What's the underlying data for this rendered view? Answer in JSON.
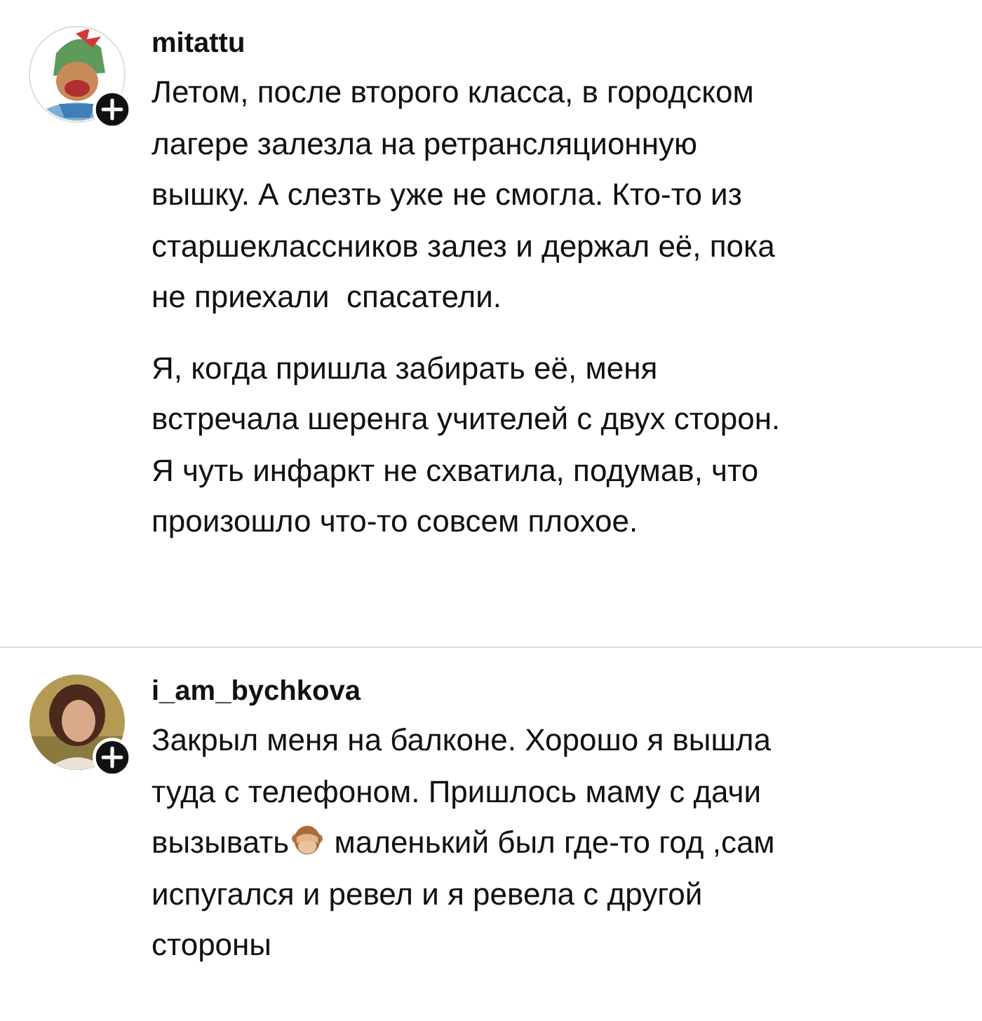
{
  "comments": [
    {
      "username": "mitattu",
      "avatar": {
        "kind": "cartoon"
      },
      "paragraphs": [
        [
          "Летом, после второго класса, в городском",
          "лагере залезла на ретрансляционную",
          "вышку. А слезть уже не смогла. Кто-то из",
          "старшеклассников залез и держал её, пока",
          "не приехали  спасатели."
        ],
        [
          "Я, когда пришла забирать её, меня",
          "встречала шеренга учителей с двух сторон.",
          "Я чуть инфаркт не схватила, подумав, что",
          "произошло что-то совсем плохое."
        ]
      ]
    },
    {
      "username": "i_am_bychkova",
      "avatar": {
        "kind": "photo"
      },
      "paragraphs": [
        [
          "Закрыл меня на балконе. Хорошо я вышла",
          "туда с телефоном. Пришлось маму с дачи",
          [
            {
              "kind": "text",
              "text": "вызывать"
            },
            {
              "kind": "emoji"
            },
            {
              "kind": "text",
              "text": " маленький был где-то год ,сам"
            }
          ],
          "испугался и ревел и я ревела с другой",
          "стороны"
        ]
      ]
    }
  ]
}
